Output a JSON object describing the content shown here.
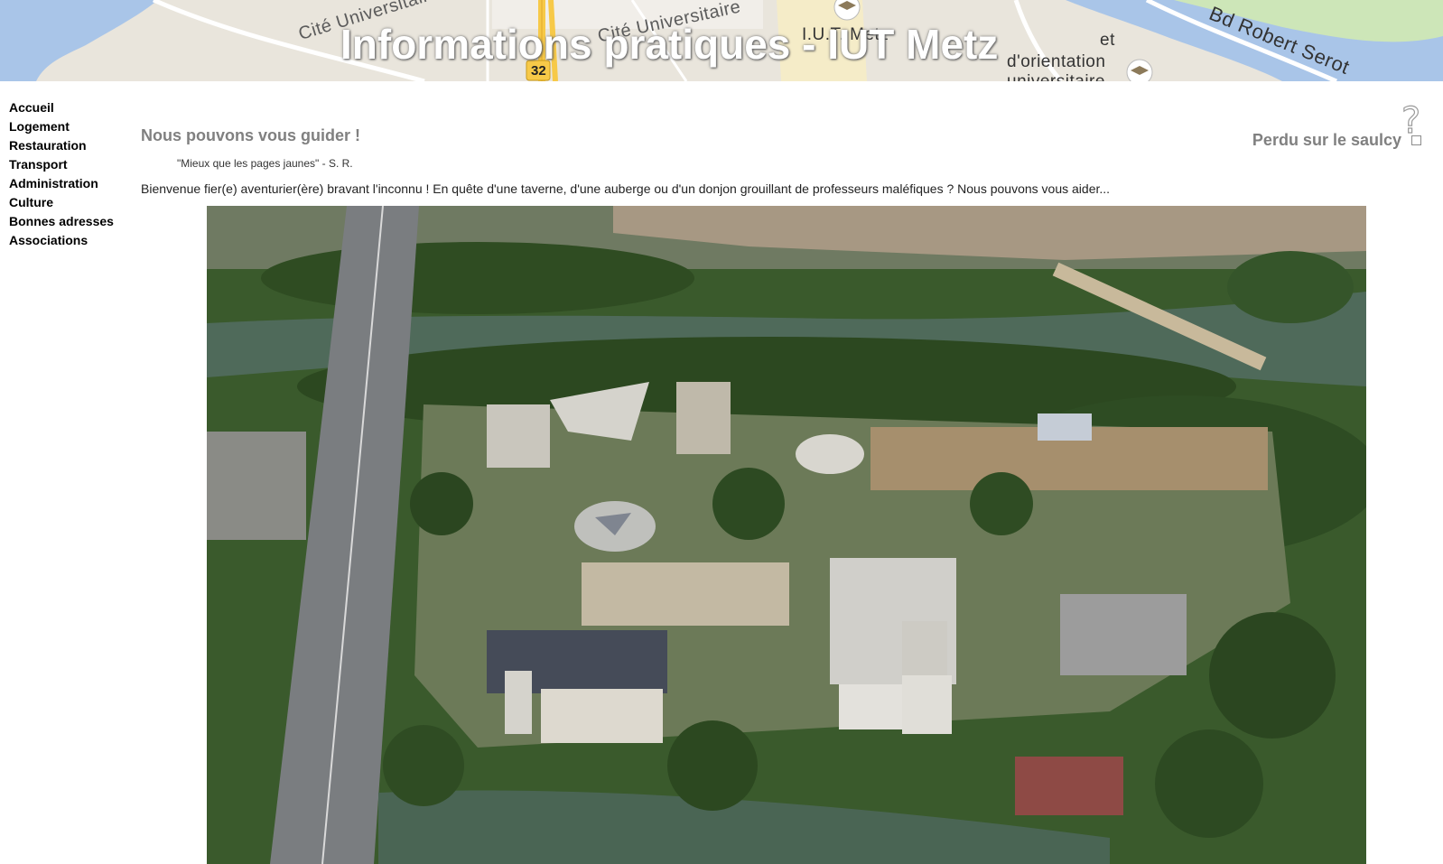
{
  "banner": {
    "title": "Informations pratiques - IUT Metz",
    "map_labels": {
      "cite_left": "Cité Universitaire",
      "cite_right": "Cité Universitaire",
      "iut": "I.U.T. Metz",
      "orientation_line1": "et",
      "orientation_line2": "d'orientation",
      "orientation_line3": "universitaire",
      "boulevard": "Bd Robert Serot",
      "route_number": "32"
    }
  },
  "nav": {
    "items": [
      {
        "label": "Accueil"
      },
      {
        "label": "Logement"
      },
      {
        "label": "Restauration"
      },
      {
        "label": "Transport"
      },
      {
        "label": "Administration"
      },
      {
        "label": "Culture"
      },
      {
        "label": "Bonnes adresses"
      },
      {
        "label": "Associations"
      }
    ]
  },
  "main": {
    "heading": "Nous pouvons vous guider !",
    "quote": "\"Mieux que les pages jaunes\" - S. R.",
    "intro": "Bienvenue fier(e) aventurier(ère) bravant l'inconnu ! En quête d'une taverne, d'une auberge ou d'un donjon grouillant de professeurs maléfiques ? Nous pouvons vous aider...",
    "lost_link": "Perdu sur le saulcy",
    "help_icon": "?"
  },
  "icons": {
    "map_marker": "graduation-cap-icon",
    "help": "question-mark-icon"
  },
  "colors": {
    "heading_gray": "#808080",
    "water": "#a8c4e6",
    "park": "#c7e3b0",
    "road_yellow": "#f7c948"
  }
}
